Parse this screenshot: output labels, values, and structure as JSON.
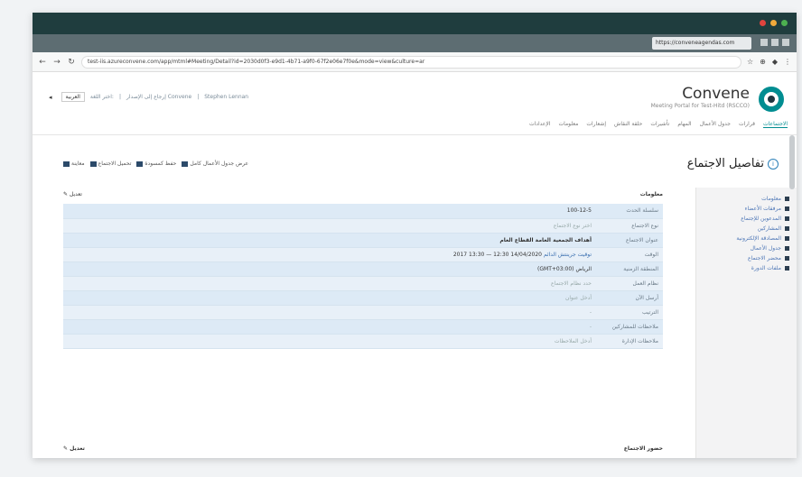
{
  "browser": {
    "tab_url": "https://conveneagendas.com",
    "url": "test-iis.azureconvene.com/app/mtml#Meeting/Detail?id=2030d0f3-e9d1-4b71-a9f0-67f2e06e7f0e&mode=view&culture=ar",
    "dot_colors": [
      "#e0443e",
      "#f0a93b",
      "#4caf50"
    ]
  },
  "app": {
    "logo_name": "Convene",
    "logo_tagline": "Meeting Portal for Test-Hitd (RSCCO)",
    "tools": {
      "lang_label": "اختر اللغة:",
      "lang_value": "العربية",
      "link1": "إرجاع إلى الإصدار Convene",
      "link2": "Stephen Lennan"
    },
    "nav": [
      "الاجتماعات",
      "قرارات",
      "جدول الأعمال",
      "المهام",
      "تأشيرات",
      "حلقة النقاش",
      "إشعارات",
      "معلومات",
      "الإعدادات"
    ],
    "nav_active_index": 0
  },
  "page": {
    "title": "تفاصيل الاجتماع",
    "actions": [
      "عرض جدول الأعمال كامل",
      "حفظ كمسودة",
      "تحميل الاجتماع",
      "معاينة"
    ],
    "section_title": "معلومات",
    "edit_label": "تعديل",
    "rows": [
      {
        "label": "سلسلة الحدث",
        "value": "100-12-5",
        "style": "normal"
      },
      {
        "label": "نوع الاجتماع",
        "value": "اختر نوع الاجتماع",
        "style": "muted"
      },
      {
        "label": "عنوان الاجتماع",
        "value": "أهداف الجمعية العامة القطاع العام",
        "style": "bold"
      },
      {
        "label": "الوقت",
        "value": "14/04/2020 12:30 — 13:30 2017",
        "extra": "توقيت جرينتش الدائم",
        "style": "normal"
      },
      {
        "label": "المنطقة الزمنية",
        "value": "(GMT+03:00) الرياض",
        "style": "normal"
      },
      {
        "label": "نظام العمل",
        "value": "حدد نظام الاجتماع",
        "style": "muted"
      },
      {
        "label": "أرسل الآن",
        "value": "أدخل عنوان",
        "style": "muted"
      },
      {
        "label": "الترتيب",
        "value": "-",
        "style": "muted"
      },
      {
        "label": "ملاحظات للمشاركين",
        "value": "-",
        "style": "muted"
      },
      {
        "label": "ملاحظات الإدارة",
        "value": "أدخل الملاحظات",
        "style": "muted"
      }
    ],
    "bottom_section": "حضور الاجتماع",
    "bottom_edit": "تعديل"
  },
  "sidebar": {
    "items": [
      "معلومات",
      "مرفقات الأعضاء",
      "المدعوين للإجتماع",
      "المشاركين",
      "المصادقة الإلكترونية",
      "جدول الأعمال",
      "محضر الاجتماع",
      "ملفات الدورة"
    ]
  }
}
